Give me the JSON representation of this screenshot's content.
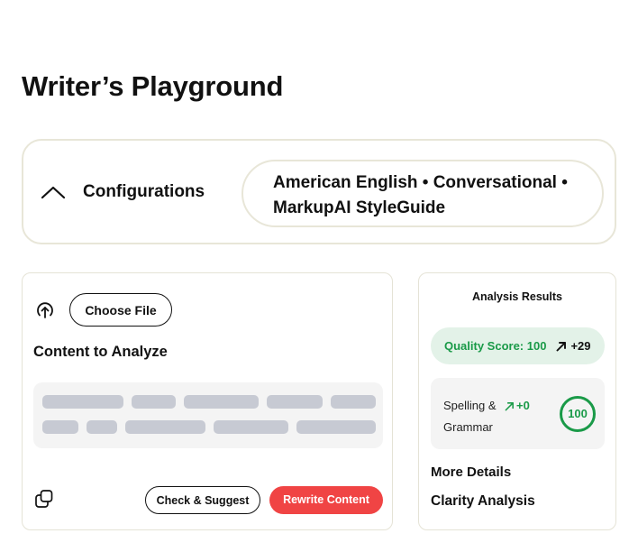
{
  "page": {
    "title": "Writer’s Playground"
  },
  "configurations": {
    "label": "Configurations",
    "summary": "American English • Conversational • MarkupAI StyleGuide"
  },
  "content": {
    "choose_file_label": "Choose File",
    "heading": "Content to Analyze",
    "check_suggest_label": "Check & Suggest",
    "rewrite_label": "Rewrite Content"
  },
  "analysis": {
    "title": "Analysis Results",
    "quality_score_label": "Quality Score: 100",
    "quality_delta": "+29",
    "spelling_label": "Spelling & Grammar",
    "spelling_delta": "+0",
    "spelling_score": "100",
    "more_details_label": "More Details",
    "clarity_label": "Clarity Analysis"
  },
  "colors": {
    "accent_red": "#f04444",
    "success_green": "#1a9a48",
    "success_bg": "#e3f2e8",
    "border_beige": "#e8e6d8",
    "skeleton_gray": "#c7cad3"
  }
}
